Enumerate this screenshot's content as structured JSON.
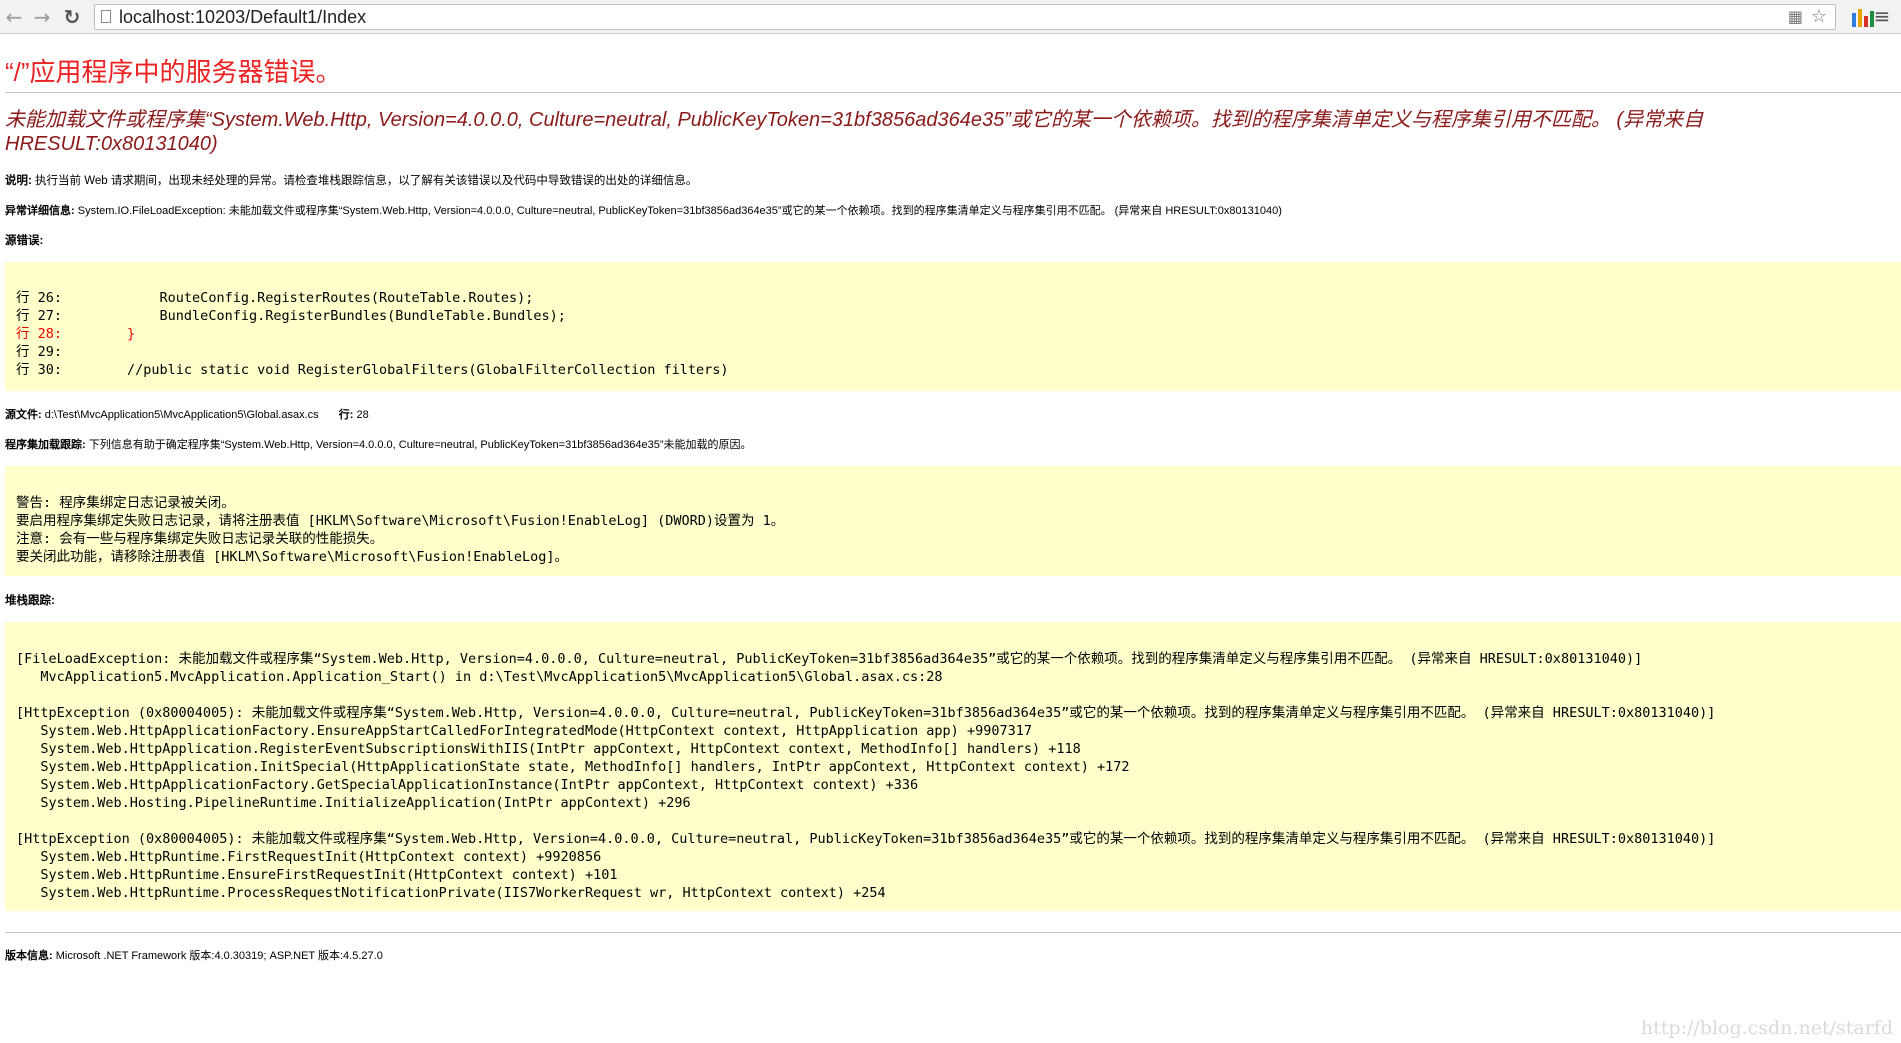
{
  "browser": {
    "url": "localhost:10203/Default1/Index"
  },
  "page": {
    "title": "“/”应用程序中的服务器错误。",
    "error_heading": "未能加载文件或程序集“System.Web.Http, Version=4.0.0.0, Culture=neutral, PublicKeyToken=31bf3856ad364e35”或它的某一个依赖项。找到的程序集清单定义与程序集引用不匹配。 (异常来自 HRESULT:0x80131040)",
    "description_label": "说明:",
    "description_text": "执行当前 Web 请求期间，出现未经处理的异常。请检查堆栈跟踪信息，以了解有关该错误以及代码中导致错误的出处的详细信息。",
    "exception_label": "异常详细信息:",
    "exception_text": "System.IO.FileLoadException: 未能加载文件或程序集“System.Web.Http, Version=4.0.0.0, Culture=neutral, PublicKeyToken=31bf3856ad364e35”或它的某一个依赖项。找到的程序集清单定义与程序集引用不匹配。 (异常来自 HRESULT:0x80131040)",
    "source_error_label": "源错误:",
    "source_lines": [
      {
        "num": "行 26:",
        "code": "            RouteConfig.RegisterRoutes(RouteTable.Routes);"
      },
      {
        "num": "行 27:",
        "code": "            BundleConfig.RegisterBundles(BundleTable.Bundles);"
      },
      {
        "num": "行 28:",
        "code": "        }"
      },
      {
        "num": "行 29:",
        "code": ""
      },
      {
        "num": "行 30:",
        "code": "        //public static void RegisterGlobalFilters(GlobalFilterCollection filters)"
      }
    ],
    "source_file_label": "源文件:",
    "source_file_path": "d:\\Test\\MvcApplication5\\MvcApplication5\\Global.asax.cs",
    "line_label": "行:",
    "line_number": "28",
    "assembly_trace_label": "程序集加载跟踪:",
    "assembly_trace_text": "下列信息有助于确定程序集“System.Web.Http, Version=4.0.0.0, Culture=neutral, PublicKeyToken=31bf3856ad364e35”未能加载的原因。",
    "assembly_trace_lines": [
      "警告: 程序集绑定日志记录被关闭。",
      "要启用程序集绑定失败日志记录，请将注册表值 [HKLM\\Software\\Microsoft\\Fusion!EnableLog] (DWORD)设置为 1。",
      "注意: 会有一些与程序集绑定失败日志记录关联的性能损失。",
      "要关闭此功能，请移除注册表值 [HKLM\\Software\\Microsoft\\Fusion!EnableLog]。"
    ],
    "stack_trace_label": "堆栈跟踪:",
    "stack_trace_lines": [
      "[FileLoadException: 未能加载文件或程序集“System.Web.Http, Version=4.0.0.0, Culture=neutral, PublicKeyToken=31bf3856ad364e35”或它的某一个依赖项。找到的程序集清单定义与程序集引用不匹配。 (异常来自 HRESULT:0x80131040)]",
      "   MvcApplication5.MvcApplication.Application_Start() in d:\\Test\\MvcApplication5\\MvcApplication5\\Global.asax.cs:28",
      "",
      "[HttpException (0x80004005): 未能加载文件或程序集“System.Web.Http, Version=4.0.0.0, Culture=neutral, PublicKeyToken=31bf3856ad364e35”或它的某一个依赖项。找到的程序集清单定义与程序集引用不匹配。 (异常来自 HRESULT:0x80131040)]",
      "   System.Web.HttpApplicationFactory.EnsureAppStartCalledForIntegratedMode(HttpContext context, HttpApplication app) +9907317",
      "   System.Web.HttpApplication.RegisterEventSubscriptionsWithIIS(IntPtr appContext, HttpContext context, MethodInfo[] handlers) +118",
      "   System.Web.HttpApplication.InitSpecial(HttpApplicationState state, MethodInfo[] handlers, IntPtr appContext, HttpContext context) +172",
      "   System.Web.HttpApplicationFactory.GetSpecialApplicationInstance(IntPtr appContext, HttpContext context) +336",
      "   System.Web.Hosting.PipelineRuntime.InitializeApplication(IntPtr appContext) +296",
      "",
      "[HttpException (0x80004005): 未能加载文件或程序集“System.Web.Http, Version=4.0.0.0, Culture=neutral, PublicKeyToken=31bf3856ad364e35”或它的某一个依赖项。找到的程序集清单定义与程序集引用不匹配。 (异常来自 HRESULT:0x80131040)]",
      "   System.Web.HttpRuntime.FirstRequestInit(HttpContext context) +9920856",
      "   System.Web.HttpRuntime.EnsureFirstRequestInit(HttpContext context) +101",
      "   System.Web.HttpRuntime.ProcessRequestNotificationPrivate(IIS7WorkerRequest wr, HttpContext context) +254"
    ],
    "version_label": "版本信息:",
    "version_text": "Microsoft .NET Framework 版本:4.0.30319; ASP.NET 版本:4.5.27.0"
  },
  "watermark": "http://blog.csdn.net/starfd",
  "colors": {
    "title_red": "#ee2222",
    "heading_maroon": "#8b1a1a",
    "code_background": "#ffffcc",
    "error_line_red": "#ee0000"
  },
  "icons": {
    "back": "arrow-left-icon",
    "forward": "arrow-right-icon",
    "reload": "reload-icon",
    "page": "page-icon",
    "translate": "translate-icon",
    "bookmark": "star-icon",
    "extension": "extension-icon",
    "menu": "menu-icon"
  }
}
